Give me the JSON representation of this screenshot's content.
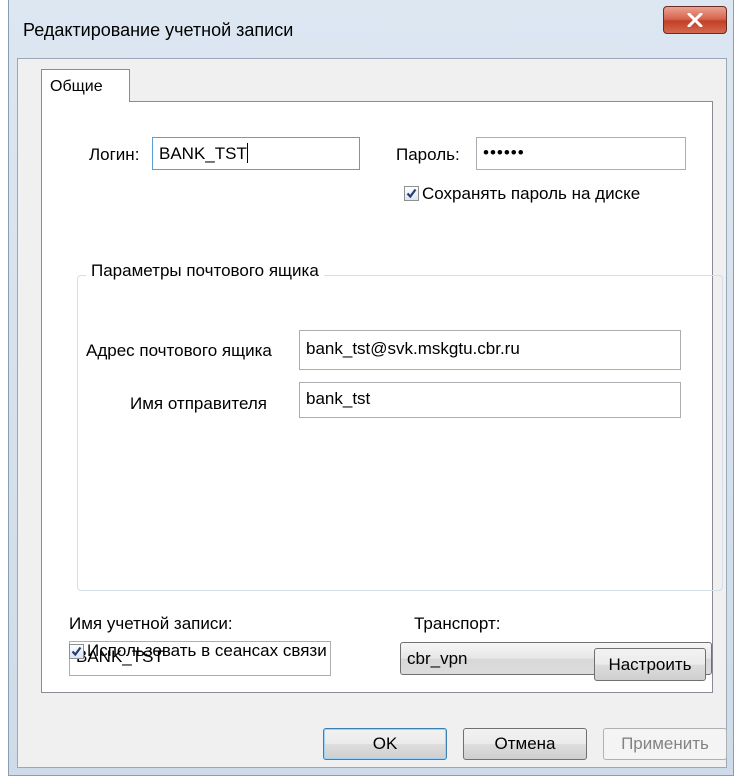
{
  "window": {
    "title": "Редактирование учетной записи",
    "close_icon": "close-icon"
  },
  "tabs": [
    {
      "label": "Общие",
      "selected": true
    }
  ],
  "login": {
    "label": "Логин:",
    "value": "BANK_TST"
  },
  "password": {
    "label": "Пароль:",
    "value": "••••••"
  },
  "save_password": {
    "label": "Сохранять пароль на диске",
    "checked": true
  },
  "mailbox": {
    "group_title": "Параметры почтового ящика",
    "address_label": "Адрес почтового ящика",
    "address_value": "bank_tst@svk.mskgtu.cbr.ru",
    "sender_label": "Имя отправителя",
    "sender_value": "bank_tst"
  },
  "account_name": {
    "label": "Имя учетной записи:",
    "value": "BANK_TST"
  },
  "transport": {
    "label": "Транспорт:",
    "selected": "cbr_vpn"
  },
  "use_in_sessions": {
    "label": "Использовать в сеансах связи",
    "checked": true
  },
  "buttons": {
    "configure": "Настроить",
    "ok": "OK",
    "cancel": "Отмена",
    "apply": "Применить"
  },
  "colors": {
    "accent": "#3c7fb1",
    "close": "#c33f28",
    "check": "#2a3b73"
  }
}
